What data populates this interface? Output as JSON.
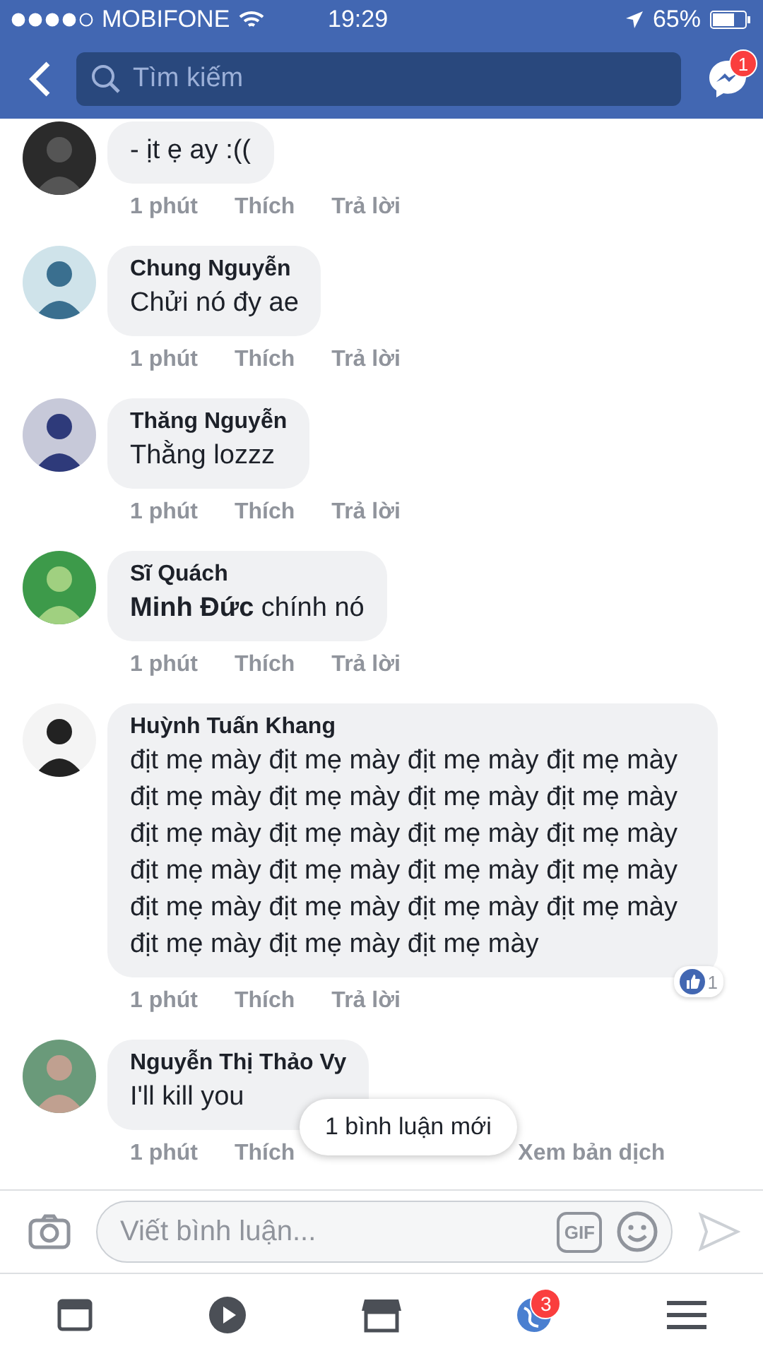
{
  "status_bar": {
    "carrier": "MOBIFONE",
    "time": "19:29",
    "battery": "65%"
  },
  "header": {
    "search": {
      "placeholder": "Tìm kiếm"
    },
    "messenger_badge": "1"
  },
  "comments": [
    {
      "text": "- ịt ẹ ay :((",
      "time": "1 phút",
      "like": "Thích",
      "reply": "Trả lời"
    },
    {
      "name": "Chung Nguyễn",
      "text": "Chửi nó đy ae",
      "time": "1 phút",
      "like": "Thích",
      "reply": "Trả lời"
    },
    {
      "name": "Thăng Nguyễn",
      "text": "Thằng lozzz",
      "time": "1 phút",
      "like": "Thích",
      "reply": "Trả lời"
    },
    {
      "name": "Sĩ Quách",
      "text": "**Minh Đức** chính nó",
      "time": "1 phút",
      "like": "Thích",
      "reply": "Trả lời"
    },
    {
      "name": "Huỳnh Tuấn Khang",
      "text": "địt mẹ mày địt mẹ mày địt mẹ mày địt mẹ mày địt mẹ mày địt mẹ mày địt mẹ mày địt mẹ mày địt mẹ mày địt mẹ mày địt mẹ mày địt mẹ mày địt mẹ mày địt mẹ mày địt mẹ mày địt mẹ mày địt mẹ mày địt mẹ mày địt mẹ mày địt mẹ mày địt mẹ mày địt mẹ mày địt mẹ mày",
      "time": "1 phút",
      "like": "Thích",
      "reply": "Trả lời",
      "reactions": "1"
    },
    {
      "name": "Nguyễn Thị Thảo Vy",
      "text": "I'll kill you",
      "time": "1 phút",
      "like": "Thích",
      "translate": "Xem bản dịch"
    }
  ],
  "new_comments_toast": "1 bình luận mới",
  "composer": {
    "placeholder": "Viết bình luận...",
    "gif": "GIF"
  },
  "tab_bar": [
    {
      "kind": "feed"
    },
    {
      "kind": "video"
    },
    {
      "kind": "market"
    },
    {
      "kind": "notifications",
      "badge": "3"
    },
    {
      "kind": "menu"
    }
  ]
}
